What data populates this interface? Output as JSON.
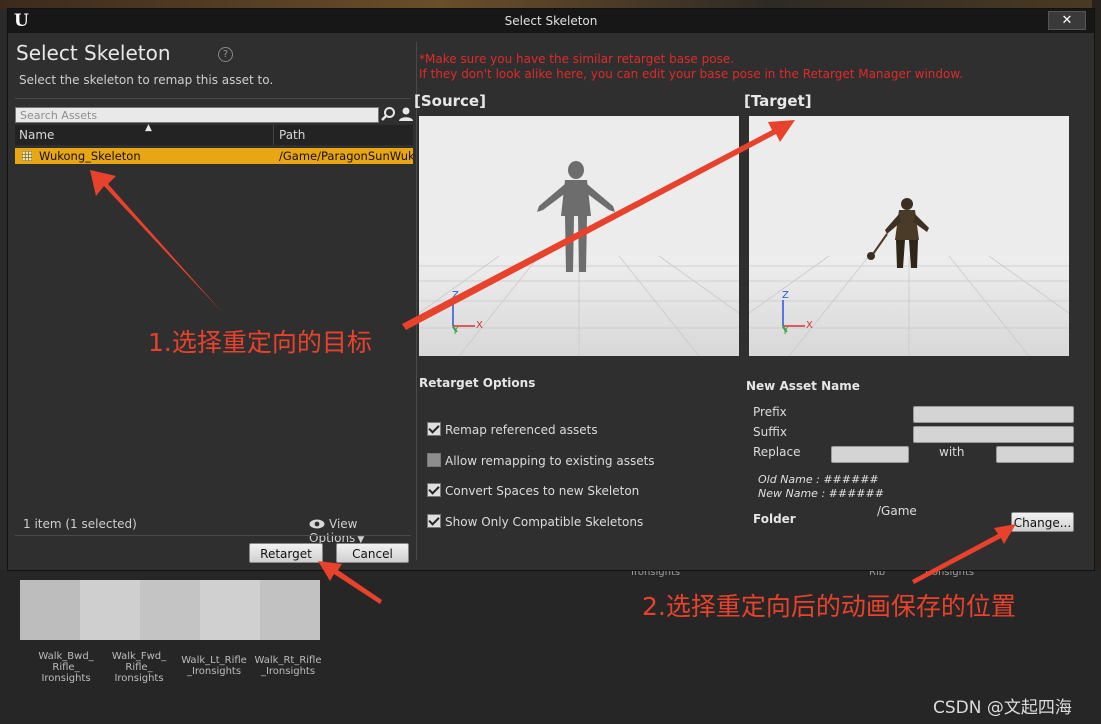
{
  "window": {
    "title": "Select Skeleton",
    "close_label": "✕"
  },
  "left": {
    "heading": "Select Skeleton",
    "help_label": "?",
    "subtitle": "Select the skeleton to remap this asset to.",
    "search_placeholder": "Search Assets",
    "columns": {
      "name": "Name",
      "path": "Path"
    },
    "rows": [
      {
        "name": "Wukong_Skeleton",
        "path": "/Game/ParagonSunWuk"
      }
    ],
    "count": "1 item (1 selected)",
    "view_options": "View Options",
    "retarget_label": "Retarget",
    "cancel_label": "Cancel"
  },
  "right": {
    "warning_line1": "*Make sure you have the similar retarget base pose.",
    "warning_line2": "If they don't look alike here, you can edit your base pose in the Retarget Manager window.",
    "source_label": "[Source]",
    "target_label": "[Target]",
    "axis": {
      "z": "Z",
      "y": "Y",
      "x": "X"
    },
    "retarget_options_title": "Retarget Options",
    "options": [
      {
        "label": "Remap referenced assets",
        "checked": true
      },
      {
        "label": "Allow remapping to existing assets",
        "checked": false
      },
      {
        "label": "Convert Spaces to new Skeleton",
        "checked": true
      },
      {
        "label": "Show Only Compatible Skeletons",
        "checked": true
      }
    ],
    "new_asset_name_title": "New Asset Name",
    "prefix_label": "Prefix",
    "suffix_label": "Suffix",
    "replace_label": "Replace",
    "with_label": "with",
    "old_name": "Old Name : ######",
    "new_name": "New Name : ######",
    "folder_label": "Folder",
    "folder_value": "/Game",
    "change_label": "Change..."
  },
  "background": {
    "assets": [
      {
        "label": "Walk_Bwd_ Rifle_ Ironsights"
      },
      {
        "label": "Walk_Fwd_ Rifle_ Ironsights"
      },
      {
        "label": "Walk_Lt_Rifle _Ironsights"
      },
      {
        "label": "Walk_Rt_Rifle _Ironsights"
      }
    ],
    "extra_1": "Ironsights",
    "extra_2": "Rib",
    "extra_3": "Ironsights"
  },
  "annotations": {
    "step1": "1.选择重定向的目标",
    "step2": "2.选择重定向后的动画保存的位置",
    "watermark": "CSDN @文起四海"
  },
  "colors": {
    "selection": "#e8a514",
    "warning": "#e02a2a",
    "annotation": "#e8422c",
    "dialog_bg": "#2f2f2f"
  }
}
